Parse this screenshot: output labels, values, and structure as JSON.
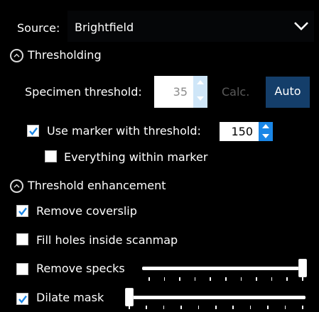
{
  "source": {
    "label": "Source:",
    "value": "Brightfield"
  },
  "thresholding": {
    "title": "Thresholding",
    "specimen_label": "Specimen threshold:",
    "specimen_value": "35",
    "calc_label": "Calc.",
    "auto_label": "Auto",
    "use_marker": {
      "label": "Use marker with threshold:",
      "checked": true,
      "value": "150"
    },
    "everything_within_marker": {
      "label": "Everything within marker",
      "checked": false
    }
  },
  "enhancement": {
    "title": "Threshold enhancement",
    "remove_coverslip": {
      "label": "Remove coverslip",
      "checked": true
    },
    "fill_holes": {
      "label": "Fill holes inside scanmap",
      "checked": false
    },
    "remove_specks": {
      "label": "Remove specks",
      "checked": false,
      "level": 1.0
    },
    "dilate_mask": {
      "label": "Dilate mask",
      "checked": true,
      "level": 0.0
    }
  },
  "colors": {
    "background": "#000000",
    "accent": "#1a86e6",
    "auto_button": "#143e6a"
  },
  "icons": {
    "dropdown": "chevron-down-icon",
    "collapse": "chevron-up-circle-icon",
    "check": "check-icon"
  }
}
